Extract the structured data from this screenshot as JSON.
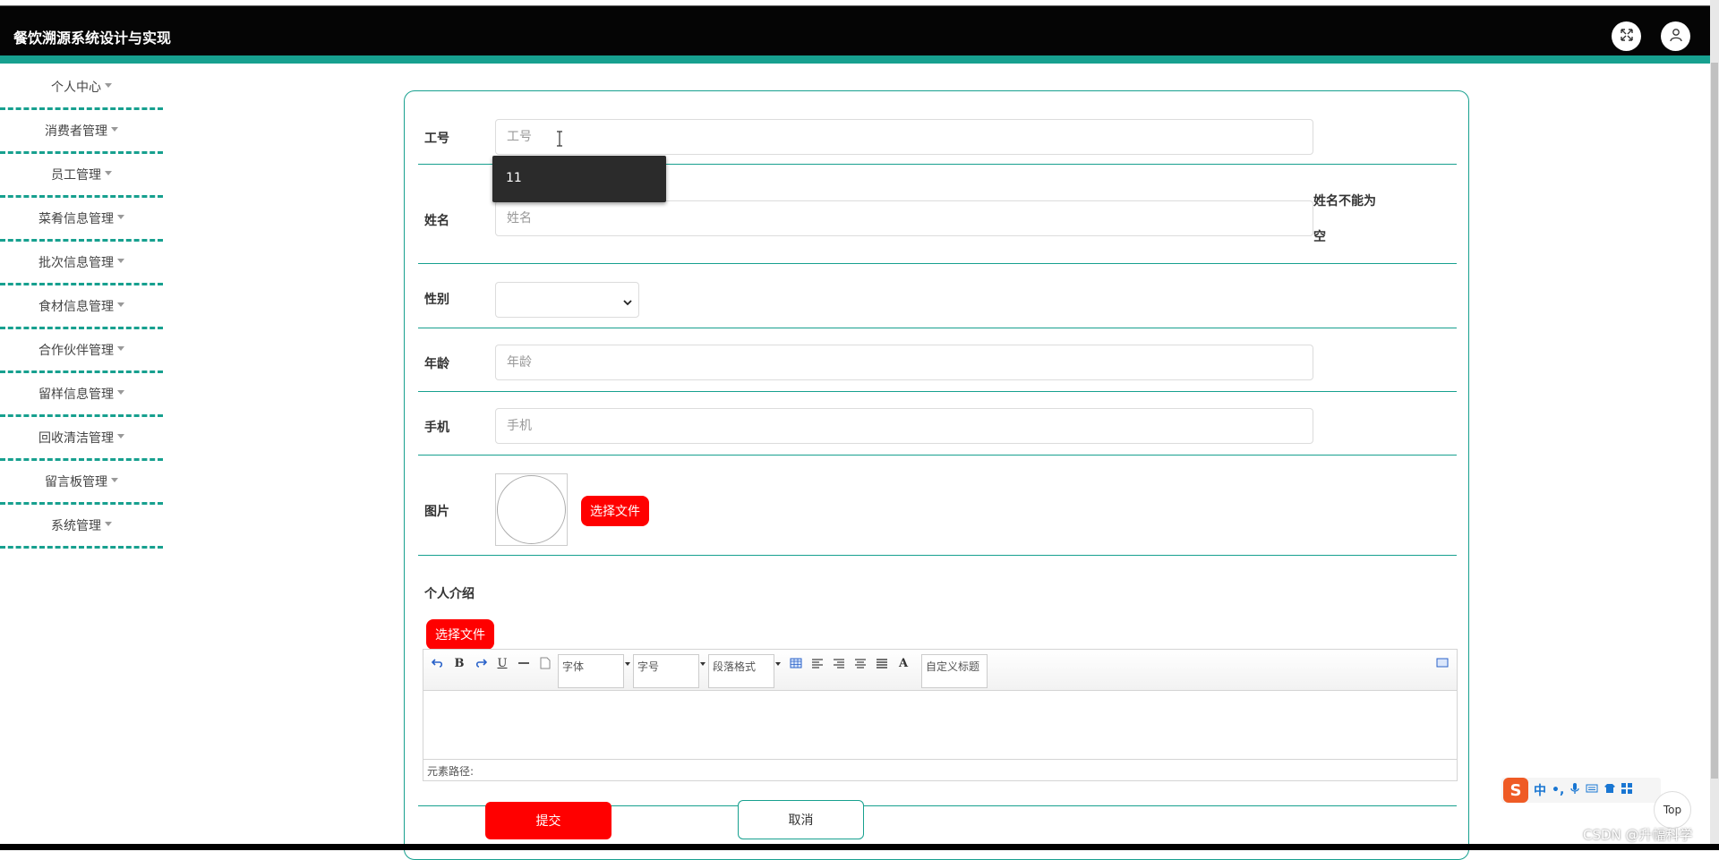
{
  "header": {
    "title": "餐饮溯源系统设计与实现"
  },
  "sidebar": {
    "items": [
      {
        "label": "个人中心"
      },
      {
        "label": "消费者管理"
      },
      {
        "label": "员工管理"
      },
      {
        "label": "菜肴信息管理"
      },
      {
        "label": "批次信息管理"
      },
      {
        "label": "食材信息管理"
      },
      {
        "label": "合作伙伴管理"
      },
      {
        "label": "留样信息管理"
      },
      {
        "label": "回收清洁管理"
      },
      {
        "label": "留言板管理"
      },
      {
        "label": "系统管理"
      }
    ]
  },
  "form": {
    "employee_no": {
      "label": "工号",
      "placeholder": "工号",
      "value": ""
    },
    "autocomplete": {
      "option": "11"
    },
    "name": {
      "label": "姓名",
      "placeholder": "姓名",
      "value": "",
      "error_line1": "姓名不能为",
      "error_line2": "空"
    },
    "gender": {
      "label": "性别",
      "value": ""
    },
    "age": {
      "label": "年龄",
      "placeholder": "年龄",
      "value": ""
    },
    "phone": {
      "label": "手机",
      "placeholder": "手机",
      "value": ""
    },
    "picture": {
      "label": "图片",
      "choose_file": "选择文件"
    },
    "intro": {
      "label": "个人介绍",
      "choose_file": "选择文件"
    },
    "editor": {
      "font_family": "字体",
      "font_size": "字号",
      "paragraph": "段落格式",
      "custom_title": "自定义标题",
      "font_color_glyph": "A",
      "bold_glyph": "B",
      "underline_glyph": "U",
      "element_path": "元素路径:"
    },
    "submit": "提交",
    "cancel": "取消"
  },
  "ime": {
    "logo": "S",
    "mode": "中",
    "punct": "•,"
  },
  "floating": {
    "top": "Top"
  },
  "watermark": "CSDN @升幅科学",
  "colors": {
    "accent": "#17a08f",
    "danger": "#ff0000",
    "header_bg": "#050505"
  }
}
